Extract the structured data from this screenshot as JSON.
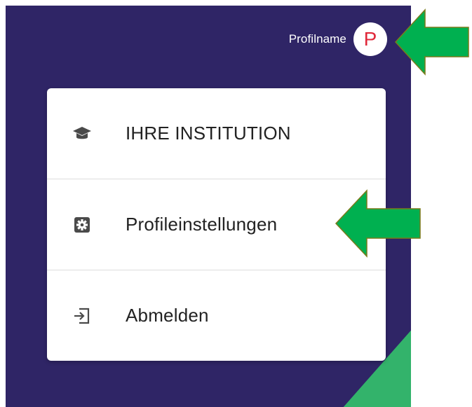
{
  "colors": {
    "panel_bg": "#2f2566",
    "accent_green": "#33b36b",
    "arrow_fill": "#00b050",
    "avatar_letter": "#e0283a"
  },
  "header": {
    "profile_name": "Profilname",
    "avatar_initial": "P"
  },
  "menu": {
    "items": [
      {
        "label": "IHRE INSTITUTION",
        "icon": "graduation-cap-icon"
      },
      {
        "label": "Profileinstellungen",
        "icon": "gear-icon"
      },
      {
        "label": "Abmelden",
        "icon": "logout-icon"
      }
    ]
  },
  "annotations": {
    "arrows": [
      "arrow-pointing-at-avatar",
      "arrow-pointing-at-profile-settings"
    ]
  }
}
